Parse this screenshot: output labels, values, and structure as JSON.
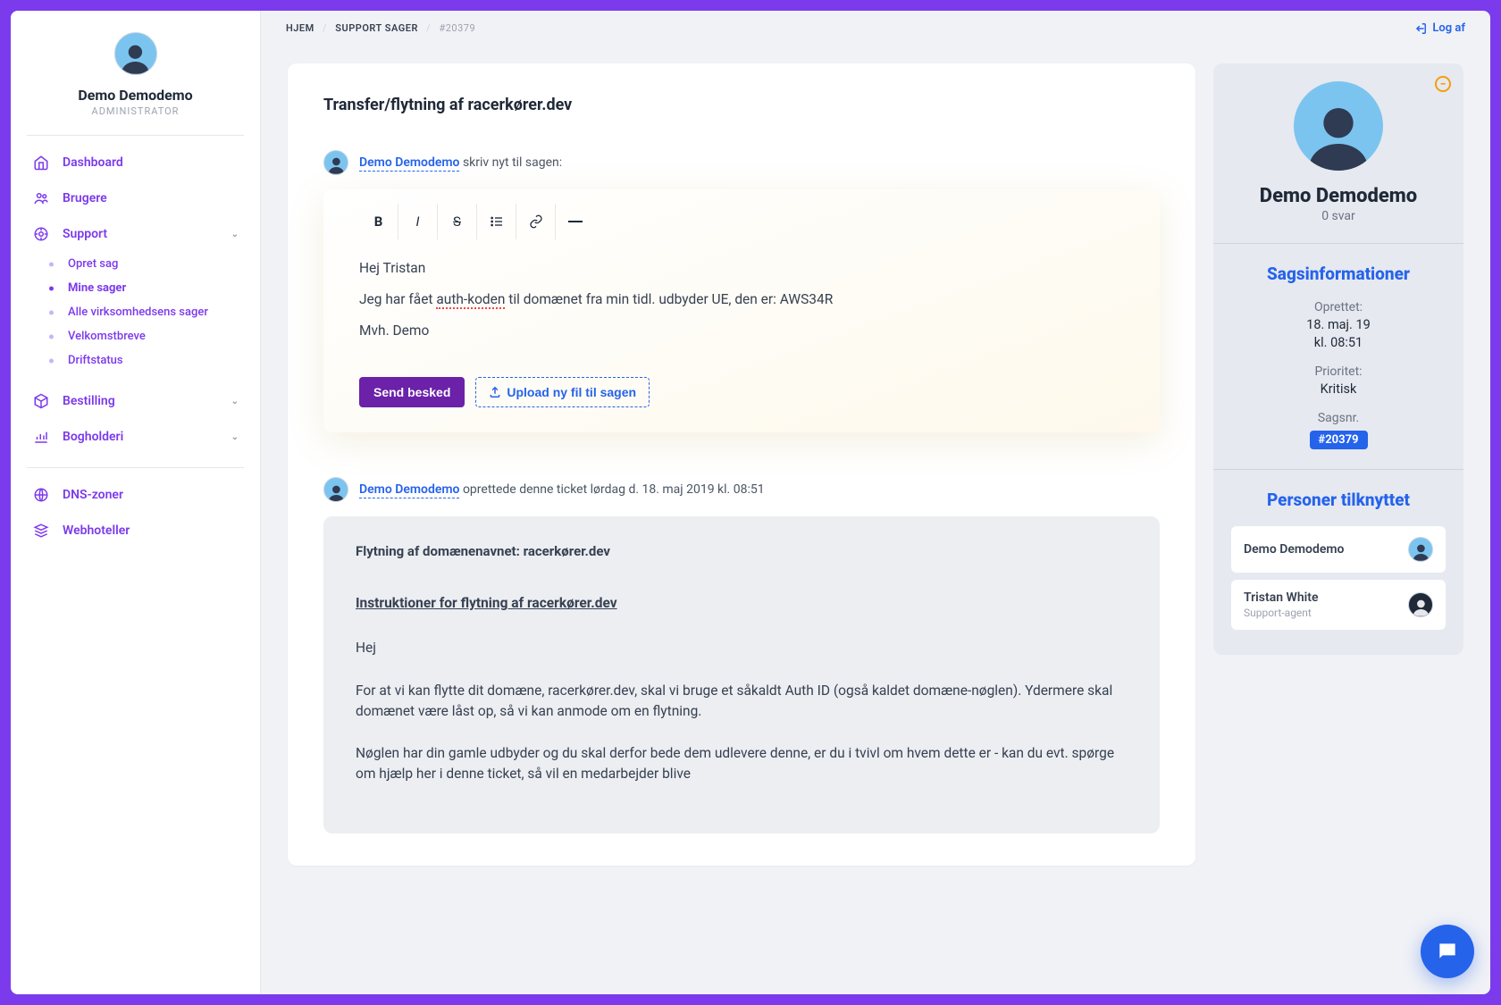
{
  "profile": {
    "name": "Demo Demodemo",
    "role": "ADMINISTRATOR"
  },
  "nav": {
    "dashboard": "Dashboard",
    "users": "Brugere",
    "support": "Support",
    "support_items": {
      "create": "Opret sag",
      "mine": "Mine sager",
      "all": "Alle virksomhedsens sager",
      "welcome": "Velkomstbreve",
      "status": "Driftstatus"
    },
    "ordering": "Bestilling",
    "accounting": "Bogholderi",
    "dns": "DNS-zoner",
    "webhotel": "Webhoteller"
  },
  "breadcrumbs": {
    "home": "HJEM",
    "cases": "SUPPORT SAGER",
    "current": "#20379"
  },
  "logout": "Log af",
  "page_title": "Transfer/flytning af racerkører.dev",
  "compose": {
    "user": "Demo Demodemo",
    "prompt": "skriv nyt til sagen:",
    "line1": "Hej Tristan",
    "line2a": "Jeg har fået ",
    "line2_err": "auth-koden",
    "line2b": " til domænet fra min tidl. udbyder UE, den er: AWS34R",
    "line3": "Mvh. Demo",
    "send": "Send besked",
    "upload": "Upload ny fil til sagen"
  },
  "ticket": {
    "author": "Demo Demodemo",
    "meta": "oprettede denne ticket",
    "timestamp": "lørdag d. 18. maj 2019 kl. 08:51",
    "subject": "Flytning af domænenavnet: racerkører.dev",
    "instructions_heading": "Instruktioner for flytning af racerkører.dev",
    "p1": "Hej",
    "p2": "For at vi kan flytte dit domæne, racerkører.dev, skal vi bruge et såkaldt Auth ID (også kaldet domæne-nøglen). Ydermere skal domænet være låst op, så vi kan anmode om en flytning.",
    "p3": "Nøglen har din gamle udbyder og du skal derfor bede dem udlevere denne, er du i tvivl om hvem dette er - kan du evt. spørge om hjælp her i denne ticket, så vil en medarbejder blive"
  },
  "side": {
    "name": "Demo Demodemo",
    "replies": "0 svar",
    "info_heading": "Sagsinformationer",
    "created_label": "Oprettet:",
    "created_date": "18. maj. 19",
    "created_time": "kl. 08:51",
    "priority_label": "Prioritet:",
    "priority_value": "Kritisk",
    "case_label": "Sagsnr.",
    "case_value": "#20379",
    "people_heading": "Personer tilknyttet",
    "people": [
      {
        "name": "Demo Demodemo",
        "role": ""
      },
      {
        "name": "Tristan White",
        "role": "Support-agent"
      }
    ]
  }
}
